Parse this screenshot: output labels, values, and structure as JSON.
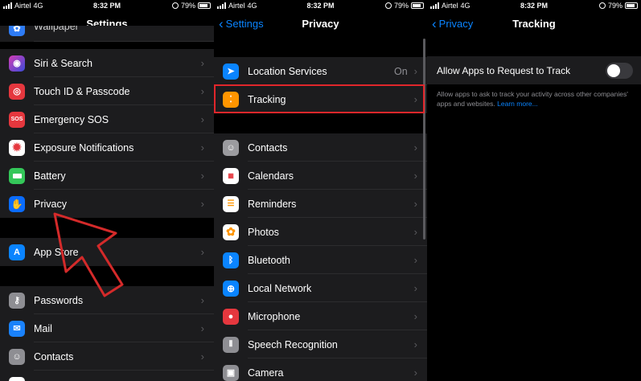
{
  "status_bar": {
    "carrier": "Airtel",
    "network": "4G",
    "time": "8:32 PM",
    "battery": "79%"
  },
  "settings": {
    "title": "Settings",
    "partial_top_label": "Wallpaper",
    "items": [
      {
        "label": "Siri & Search",
        "icon": "siri-icon",
        "color": "#1c1c1e"
      },
      {
        "label": "Touch ID & Passcode",
        "icon": "fingerprint-icon",
        "color": "#e5373e"
      },
      {
        "label": "Emergency SOS",
        "icon": "sos-icon",
        "color": "#e5373e",
        "icon_text": "SOS"
      },
      {
        "label": "Exposure Notifications",
        "icon": "exposure-icon",
        "color": "#ffffff"
      },
      {
        "label": "Battery",
        "icon": "battery-icon",
        "color": "#34c759"
      },
      {
        "label": "Privacy",
        "icon": "hand-icon",
        "color": "#0a6cff"
      },
      {
        "label": "App Store",
        "icon": "app-store-icon",
        "color": "#0a84ff"
      },
      {
        "label": "Passwords",
        "icon": "key-icon",
        "color": "#8e8e93"
      },
      {
        "label": "Mail",
        "icon": "mail-icon",
        "color": "#1a82fb"
      },
      {
        "label": "Contacts",
        "icon": "contacts-icon",
        "color": "#8e8e93"
      }
    ]
  },
  "privacy": {
    "title": "Privacy",
    "back_label": "Settings",
    "location": {
      "label": "Location Services",
      "value": "On",
      "icon": "location-arrow-icon",
      "color": "#0a84ff"
    },
    "tracking": {
      "label": "Tracking",
      "icon": "tracking-icon",
      "color": "#ff9500"
    },
    "items": [
      {
        "label": "Contacts",
        "icon": "contacts-icon",
        "color": "#9b9b9f"
      },
      {
        "label": "Calendars",
        "icon": "calendar-icon",
        "color": "#ffffff"
      },
      {
        "label": "Reminders",
        "icon": "reminders-icon",
        "color": "#ffffff"
      },
      {
        "label": "Photos",
        "icon": "photos-icon",
        "color": "#ffffff"
      },
      {
        "label": "Bluetooth",
        "icon": "bluetooth-icon",
        "color": "#0a84ff"
      },
      {
        "label": "Local Network",
        "icon": "globe-icon",
        "color": "#0a84ff"
      },
      {
        "label": "Microphone",
        "icon": "microphone-icon",
        "color": "#e5373e"
      },
      {
        "label": "Speech Recognition",
        "icon": "waveform-icon",
        "color": "#8e8e93"
      },
      {
        "label": "Camera",
        "icon": "camera-icon",
        "color": "#8e8e93"
      }
    ]
  },
  "tracking": {
    "title": "Tracking",
    "back_label": "Privacy",
    "toggle_label": "Allow Apps to Request to Track",
    "toggle_on": false,
    "note": "Allow apps to ask to track your activity across other companies' apps and websites.",
    "learn_more": "Learn more..."
  }
}
